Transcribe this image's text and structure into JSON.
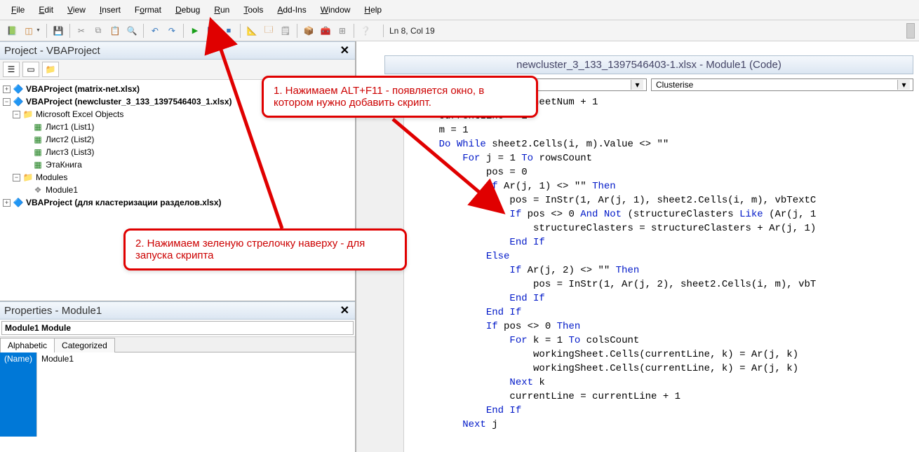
{
  "menu": {
    "file": "File",
    "edit": "Edit",
    "view": "View",
    "insert": "Insert",
    "format": "Format",
    "debug": "Debug",
    "run": "Run",
    "tools": "Tools",
    "addins": "Add-Ins",
    "window": "Window",
    "help": "Help"
  },
  "toolbar": {
    "cursor_pos": "Ln 8, Col 19"
  },
  "project_panel": {
    "title": "Project - VBAProject",
    "items": {
      "p1": "VBAProject (matrix-net.xlsx)",
      "p2": "VBAProject (newcluster_3_133_1397546403_1.xlsx)",
      "folder1": "Microsoft Excel Objects",
      "sheet1": "Лист1 (List1)",
      "sheet2": "Лист2 (List2)",
      "sheet3": "Лист3 (List3)",
      "thisworkbook": "ЭтаКнига",
      "folder2": "Modules",
      "module1": "Module1",
      "p3": "VBAProject (для кластеризации разделов.xlsx)"
    }
  },
  "properties_panel": {
    "title": "Properties - Module1",
    "object": "Module1 Module",
    "tab_alpha": "Alphabetic",
    "tab_cat": "Categorized",
    "row_name": "(Name)",
    "row_val": "Module1"
  },
  "code_window": {
    "title": "newcluster_3_133_1397546403-1.xlsx - Module1 (Code)",
    "dd_left": "",
    "dd_right": "Clusterise"
  },
  "code_lines": [
    {
      "indent": 1,
      "pre": "etNum = workingSheetNum + 1"
    },
    {
      "indent": 1,
      "pre": "currentLine = 1"
    },
    {
      "indent": 1,
      "pre": "m = 1"
    },
    {
      "indent": 1,
      "segs": [
        {
          "t": "Do While",
          "k": true
        },
        {
          "t": " sheet2.Cells(i, m).Value <> \"\""
        }
      ]
    },
    {
      "indent": 2,
      "segs": [
        {
          "t": "For",
          "k": true
        },
        {
          "t": " j = 1 "
        },
        {
          "t": "To",
          "k": true
        },
        {
          "t": " rowsCount"
        }
      ]
    },
    {
      "indent": 3,
      "pre": "pos = 0"
    },
    {
      "indent": 3,
      "segs": [
        {
          "t": "If",
          "k": true
        },
        {
          "t": " Ar(j, 1) <> \"\" "
        },
        {
          "t": "Then",
          "k": true
        }
      ]
    },
    {
      "indent": 4,
      "pre": "pos = InStr(1, Ar(j, 1), sheet2.Cells(i, m), vbTextC"
    },
    {
      "indent": 4,
      "segs": [
        {
          "t": "If",
          "k": true
        },
        {
          "t": " pos <> 0 "
        },
        {
          "t": "And Not",
          "k": true
        },
        {
          "t": " (structureClasters "
        },
        {
          "t": "Like",
          "k": true
        },
        {
          "t": " (Ar(j, 1"
        }
      ]
    },
    {
      "indent": 5,
      "pre": "structureClasters = structureClasters + Ar(j, 1)"
    },
    {
      "indent": 4,
      "segs": [
        {
          "t": "End If",
          "k": true
        }
      ]
    },
    {
      "indent": 3,
      "segs": [
        {
          "t": "Else",
          "k": true
        }
      ]
    },
    {
      "indent": 4,
      "segs": [
        {
          "t": "If",
          "k": true
        },
        {
          "t": " Ar(j, 2) <> \"\" "
        },
        {
          "t": "Then",
          "k": true
        }
      ]
    },
    {
      "indent": 5,
      "pre": "pos = InStr(1, Ar(j, 2), sheet2.Cells(i, m), vbT"
    },
    {
      "indent": 4,
      "segs": [
        {
          "t": "End If",
          "k": true
        }
      ]
    },
    {
      "indent": 3,
      "segs": [
        {
          "t": "End If",
          "k": true
        }
      ]
    },
    {
      "indent": 3,
      "segs": [
        {
          "t": "If",
          "k": true
        },
        {
          "t": " pos <> 0 "
        },
        {
          "t": "Then",
          "k": true
        }
      ]
    },
    {
      "indent": 4,
      "segs": [
        {
          "t": "For",
          "k": true
        },
        {
          "t": " k = 1 "
        },
        {
          "t": "To",
          "k": true
        },
        {
          "t": " colsCount"
        }
      ]
    },
    {
      "indent": 5,
      "pre": "workingSheet.Cells(currentLine, k) = Ar(j, k)"
    },
    {
      "indent": 5,
      "pre": "workingSheet.Cells(currentLine, k) = Ar(j, k)"
    },
    {
      "indent": 4,
      "segs": [
        {
          "t": "Next",
          "k": true
        },
        {
          "t": " k"
        }
      ]
    },
    {
      "indent": 4,
      "pre": "currentLine = currentLine + 1"
    },
    {
      "indent": 3,
      "segs": [
        {
          "t": "End If",
          "k": true
        }
      ]
    },
    {
      "indent": 2,
      "segs": [
        {
          "t": "Next",
          "k": true
        },
        {
          "t": " j"
        }
      ]
    }
  ],
  "callouts": {
    "c1": "1. Нажимаем ALT+F11  - появляется окно, в котором нужно добавить скрипт.",
    "c2": "2.  Нажимаем зеленую стрелочку наверху - для запуска скрипта"
  },
  "icons": {
    "excel": "📗",
    "save": "💾",
    "cut": "✂",
    "copy": "⧉",
    "paste": "📋",
    "find": "🔍",
    "undo": "↶",
    "redo": "↷",
    "play": "▶",
    "pause": "❚❚",
    "stop": "■",
    "design": "📐",
    "folder": "📁",
    "folder_yellow": "🗂",
    "module": "📄",
    "book": "📘",
    "vba": "🔷"
  }
}
